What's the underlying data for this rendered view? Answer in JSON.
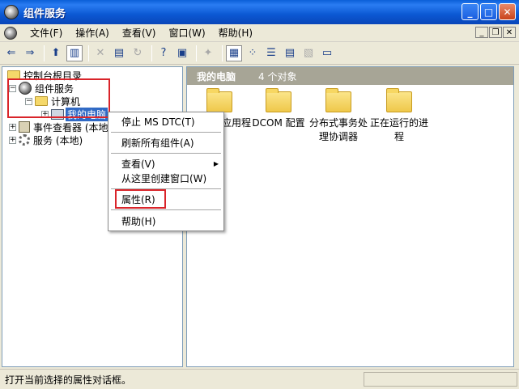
{
  "window": {
    "title": "组件服务"
  },
  "menu": {
    "items": [
      "文件(F)",
      "操作(A)",
      "查看(V)",
      "窗口(W)",
      "帮助(H)"
    ],
    "mdi_buttons": [
      "_",
      "❐",
      "✕"
    ]
  },
  "toolbar": {
    "buttons": [
      "back-arrow",
      "forward-arrow",
      "up-folder",
      "show-tree",
      "delete",
      "properties",
      "refresh",
      "help",
      "export",
      "new",
      "large-icons",
      "small-icons",
      "list",
      "details",
      "computer"
    ]
  },
  "tree": {
    "root": "控制台根目录",
    "component_services": "组件服务",
    "computers": "计算机",
    "my_computer": "我的电脑",
    "event_viewer": "事件查看器 (本地)",
    "services": "服务 (本地)",
    "expander_minus": "−",
    "expander_plus": "+"
  },
  "right_pane": {
    "title": "我的电脑",
    "count": "4 个对象",
    "items": [
      "COM+ 应用程序",
      "DCOM 配置",
      "分布式事务处理协调器",
      "正在运行的进程"
    ]
  },
  "context_menu": {
    "items": [
      "停止 MS DTC(T)",
      "刷新所有组件(A)",
      "查看(V)",
      "从这里创建窗口(W)",
      "属性(R)",
      "帮助(H)"
    ]
  },
  "status": {
    "text": "打开当前选择的属性对话框。"
  },
  "colors": {
    "highlight_box": "#d9242a",
    "selection": "#316ac5",
    "title_bar": "#0a5fd8"
  }
}
